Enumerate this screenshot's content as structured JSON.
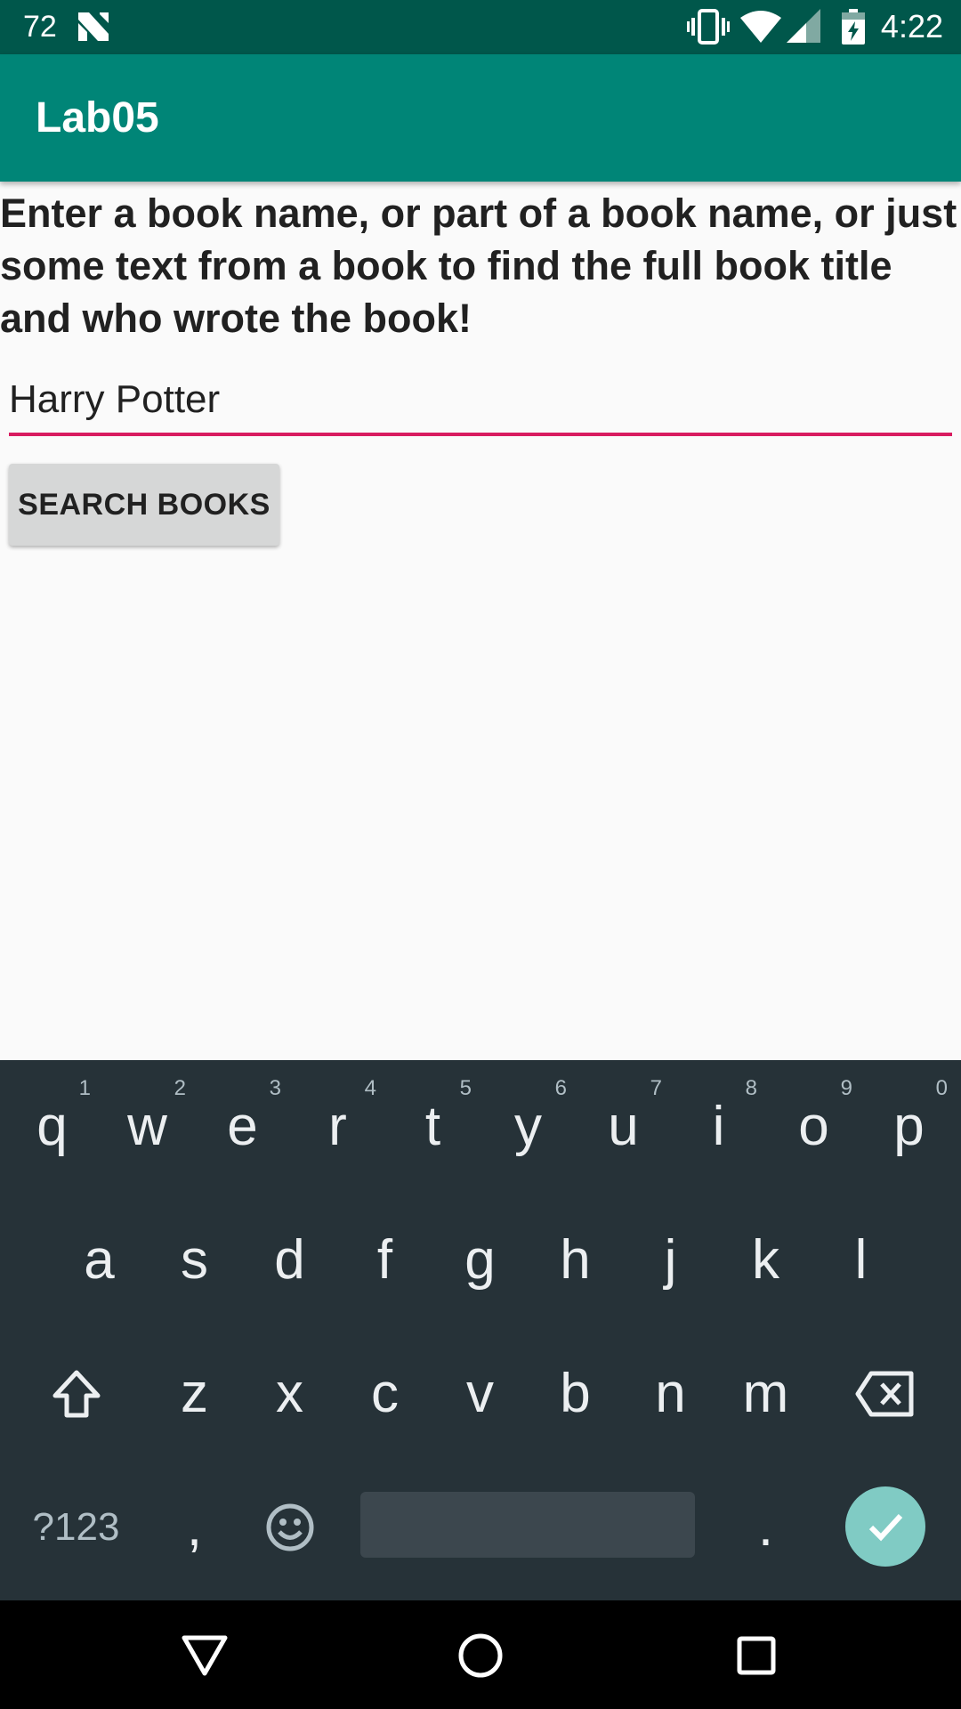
{
  "status_bar": {
    "left_number": "72",
    "time": "4:22",
    "icons": [
      "n-icon",
      "vibrate-icon",
      "wifi-icon",
      "signal-icon",
      "battery-charging-icon"
    ]
  },
  "app_bar": {
    "title": "Lab05"
  },
  "main": {
    "instructions": "Enter a book name, or part of a book name, or just some text from a book to find the full book title and who wrote the book!",
    "search_value": "Harry Potter",
    "search_button_label": "SEARCH BOOKS"
  },
  "keyboard": {
    "row1": [
      {
        "key": "q",
        "hint": "1"
      },
      {
        "key": "w",
        "hint": "2"
      },
      {
        "key": "e",
        "hint": "3"
      },
      {
        "key": "r",
        "hint": "4"
      },
      {
        "key": "t",
        "hint": "5"
      },
      {
        "key": "y",
        "hint": "6"
      },
      {
        "key": "u",
        "hint": "7"
      },
      {
        "key": "i",
        "hint": "8"
      },
      {
        "key": "o",
        "hint": "9"
      },
      {
        "key": "p",
        "hint": "0"
      }
    ],
    "row2": [
      "a",
      "s",
      "d",
      "f",
      "g",
      "h",
      "j",
      "k",
      "l"
    ],
    "row3": [
      "z",
      "x",
      "c",
      "v",
      "b",
      "n",
      "m"
    ],
    "symbols_label": "?123",
    "comma": ",",
    "period": ".",
    "icons": [
      "shift-icon",
      "backspace-icon",
      "emoji-icon",
      "enter-check-icon"
    ]
  },
  "nav_bar": {
    "icons": [
      "back-icon",
      "home-icon",
      "recents-icon"
    ]
  },
  "colors": {
    "status_bar": "#00574b",
    "app_bar": "#008577",
    "accent": "#d81b60",
    "keyboard_bg": "#263238",
    "enter_key": "#80cbc4"
  }
}
